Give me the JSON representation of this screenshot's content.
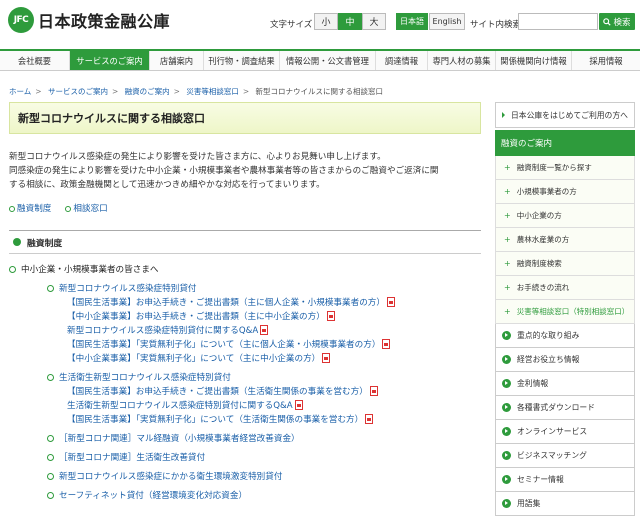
{
  "header": {
    "logo_mark": "JFC",
    "logo_text": "日本政策金融公庫",
    "font_size_label": "文字サイズ",
    "font_sizes": [
      "小",
      "中",
      "大"
    ],
    "languages": [
      "日本語",
      "English"
    ],
    "search_label": "サイト内検索",
    "search_placeholder": "",
    "search_button": "検索"
  },
  "nav": [
    "会社概要",
    "サービスのご案内",
    "店舗案内",
    "刊行物・調査結果",
    "情報公開・公文書管理",
    "調達情報",
    "専門人材の募集",
    "関係機関向け情報",
    "採用情報"
  ],
  "breadcrumb": [
    "ホーム",
    "サービスのご案内",
    "融資のご案内",
    "災害等相談窓口",
    "新型コロナウイルスに関する相談窓口"
  ],
  "page": {
    "title": "新型コロナウイルスに関する相談窓口",
    "intro": [
      "新型コロナウイルス感染症の発生により影響を受けた皆さま方に、心よりお見舞い申し上げます。",
      "同感染症の発生により影響を受けた中小企業・小規模事業者や農林事業者等の皆さまからのご融資やご返済に関",
      "する相談に、政策金融機関として迅速かつきめ細やかな対応を行ってまいります。"
    ],
    "anchors": [
      "融資制度",
      "相談窓口"
    ],
    "section_title": "融資制度",
    "audience": "中小企業・小規模事業者の皆さまへ",
    "items": [
      {
        "label": "新型コロナウイルス感染症特別貸付",
        "level": 2
      },
      {
        "label": "【国民生活事業】お申込手続き・ご提出書類（主に個人企業・小規模事業者の方）",
        "level": 3,
        "pdf": true
      },
      {
        "label": "【中小企業事業】お申込手続き・ご提出書類（主に中小企業の方）",
        "level": 3,
        "pdf": true
      },
      {
        "label": "新型コロナウイルス感染症特別貸付に関するQ&A",
        "level": 3,
        "pdf": true
      },
      {
        "label": "【国民生活事業】「実質無利子化」について（主に個人企業・小規模事業者の方）",
        "level": 3,
        "pdf": true
      },
      {
        "label": "【中小企業事業】「実質無利子化」について（主に中小企業の方）",
        "level": 3,
        "pdf": true
      },
      {
        "label": "生活衛生新型コロナウイルス感染症特別貸付",
        "level": 2
      },
      {
        "label": "【国民生活事業】お申込手続き・ご提出書類（生活衛生関係の事業を営む方）",
        "level": 3,
        "pdf": true
      },
      {
        "label": "生活衛生新型コロナウイルス感染症特別貸付に関するQ&A",
        "level": 3,
        "pdf": true
      },
      {
        "label": "【国民生活事業】「実質無利子化」について（生活衛生関係の事業を営む方）",
        "level": 3,
        "pdf": true
      },
      {
        "label": "［新型コロナ関連］マル経融資（小規模事業者経営改善資金）",
        "level": 2
      },
      {
        "label": "［新型コロナ関連］生活衛生改善貸付",
        "level": 2
      },
      {
        "label": "新型コロナウイルス感染症にかかる衛生環境激変特別貸付",
        "level": 2
      },
      {
        "label": "セーフティネット貸付（経営環境変化対応資金）",
        "level": 2
      }
    ]
  },
  "sidebar": {
    "top": "日本公庫をはじめてご利用の方へ",
    "current": "融資のご案内",
    "sub": [
      "融資制度一覧から探す",
      "小規模事業者の方",
      "中小企業の方",
      "農林水産業の方",
      "融資制度検索",
      "お手続きの流れ",
      "災害等相談窓口（特別相談窓口）"
    ],
    "main": [
      "重点的な取り組み",
      "経営お役立ち情報",
      "金利情報",
      "各種書式ダウンロード",
      "オンラインサービス",
      "ビジネスマッチング",
      "セミナー情報",
      "用語集"
    ]
  }
}
